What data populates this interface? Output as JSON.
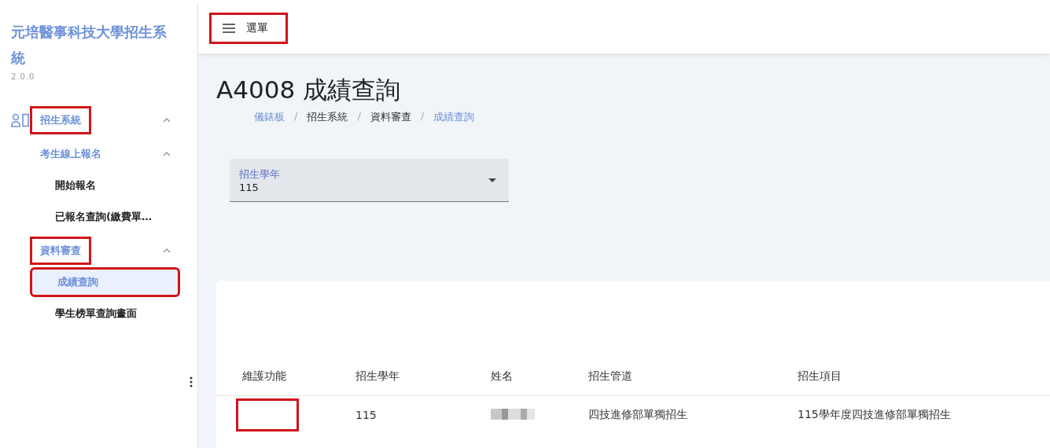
{
  "sidebar": {
    "title": "元培醫事科技大學招生系統",
    "version": "2.0.0",
    "items": [
      {
        "label": "招生系統",
        "expanded": true,
        "annotated": true,
        "children": [
          {
            "label": "考生線上報名",
            "expanded": true,
            "annotated": false,
            "children": [
              {
                "label": "開始報名",
                "annotated": false,
                "selected": false
              },
              {
                "label": "已報名查詢(繳費單…",
                "annotated": false,
                "selected": false
              }
            ]
          },
          {
            "label": "資料審查",
            "expanded": true,
            "annotated": true,
            "children": [
              {
                "label": "成績查詢",
                "annotated": true,
                "selected": true
              },
              {
                "label": "學生榜單查詢畫面",
                "annotated": false,
                "selected": false
              }
            ]
          }
        ]
      }
    ]
  },
  "top_bar": {
    "menu_label": "選單",
    "annotated": true
  },
  "page": {
    "title": "A4008 成績查詢",
    "breadcrumbs": [
      {
        "label": "儀錶板",
        "link": true
      },
      {
        "separator": "/",
        "label": "招生系統",
        "link": false
      },
      {
        "separator": "/",
        "label": "資料審查",
        "link": false
      },
      {
        "separator": "/",
        "label": "成績查詢",
        "link": true
      }
    ],
    "year_select": {
      "label": "招生學年",
      "value": "115"
    }
  },
  "table": {
    "columns": [
      "維護功能",
      "招生學年",
      "姓名",
      "招生管道",
      "招生項目"
    ],
    "rows": [
      {
        "maintenance_annotated": true,
        "year": "115",
        "name_redacted": true,
        "channel": "四技進修部單獨招生",
        "item": "115學年度四技進修部單獨招生"
      }
    ]
  }
}
